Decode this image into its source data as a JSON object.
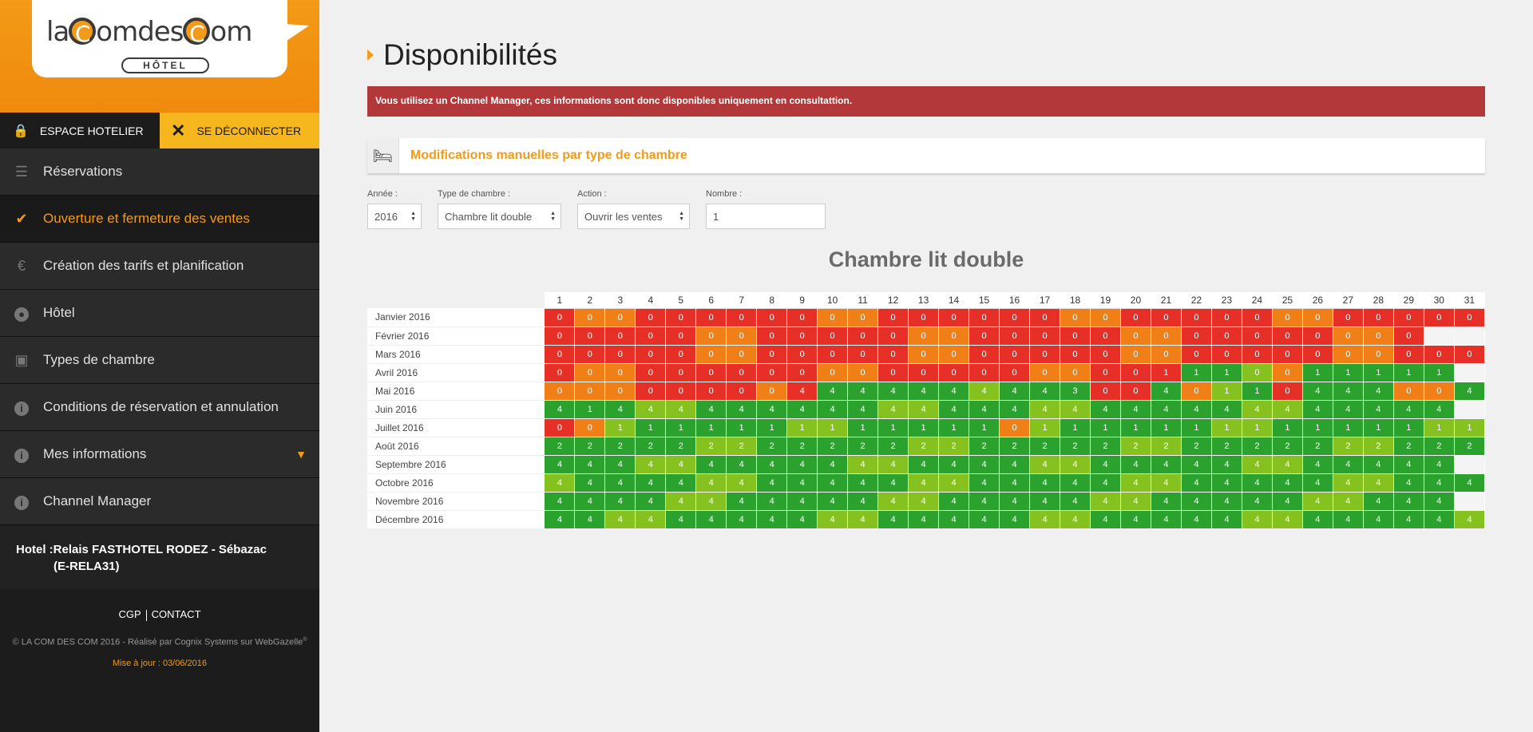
{
  "sidebar": {
    "logo_text_1": "la",
    "logo_c": "C",
    "logo_text_2": "omdes",
    "logo_text_3": "om",
    "logo_sub": "HÔTEL",
    "espace_label": "ESPACE HOTELIER",
    "logout_label": "SE DÉCONNECTER",
    "nav": [
      {
        "label": "Réservations",
        "icon": "list-icon"
      },
      {
        "label": "Ouverture et fermeture des ventes",
        "icon": "check-icon"
      },
      {
        "label": "Création des tarifs et planification",
        "icon": "euro-icon"
      },
      {
        "label": "Hôtel",
        "icon": "globe-icon"
      },
      {
        "label": "Types de chambre",
        "icon": "bookmark-icon"
      },
      {
        "label": "Conditions de réservation et annulation",
        "icon": "info-icon"
      },
      {
        "label": "Mes informations",
        "icon": "info-icon"
      },
      {
        "label": "Channel Manager",
        "icon": "info-icon"
      }
    ],
    "hotel_line1": "Hotel :Relais FASTHOTEL RODEZ - Sébazac",
    "hotel_line2": "(E-RELA31)",
    "footer_cgp": "CGP",
    "footer_contact": "CONTACT",
    "copyright": "© LA COM DES COM 2016 - Réalisé par Cognix Systems sur WebGazelle",
    "copyright_sup": "®",
    "update": "Mise à jour : 03/06/2016"
  },
  "main": {
    "title": "Disponibilités",
    "alert": "Vous utilisez un Channel Manager, ces informations sont donc disponibles uniquement en consultattion.",
    "panel_title": "Modifications manuelles par type de chambre",
    "filters": {
      "year_label": "Année :",
      "year_value": "2016",
      "type_label": "Type de chambre :",
      "type_value": "Chambre lit double",
      "action_label": "Action :",
      "action_value": "Ouvrir les ventes",
      "nombre_label": "Nombre :",
      "nombre_value": "1"
    },
    "grid_title": "Chambre lit double"
  },
  "colors": {
    "accent": "#f39a17",
    "closed_red": "#e63027",
    "low_orange": "#f07f17",
    "open_green": "#2ba12e",
    "open_lime": "#86c21f",
    "alert_red": "#b3383a"
  },
  "calendar": {
    "days": [
      "1",
      "2",
      "3",
      "4",
      "5",
      "6",
      "7",
      "8",
      "9",
      "10",
      "11",
      "12",
      "13",
      "14",
      "15",
      "16",
      "17",
      "18",
      "19",
      "20",
      "21",
      "22",
      "23",
      "24",
      "25",
      "26",
      "27",
      "28",
      "29",
      "30",
      "31"
    ],
    "legend_codes": {
      "R": "red",
      "O": "orange",
      "G": "green",
      "L": "lime"
    },
    "months": [
      {
        "name": "Janvier 2016",
        "values": "0000000000000000000000000000000",
        "colors": "ROORRRRRROORRRRRROORRRRROORRRRROO"
      },
      {
        "name": "Février 2016",
        "values": "00000000000000000000000000000",
        "colors": "RRRRROORRRRROORRRRROORRRRROORRR"
      },
      {
        "name": "Mars 2016",
        "values": "0000000000000000000000000000000",
        "colors": "RRRRROORRRRROORRRRROORRRRROORRRRR"
      },
      {
        "name": "Avril 2016",
        "values": "000000000000000000001110011111",
        "colors": "ROORRRRRROORRRRROORRRGGLOGGGGGL"
      },
      {
        "name": "Mai 2016",
        "values": "0000000044444444430040110444004 4",
        "colors": "OOORRRRORGGGGGLGGGRRGOLGRGGGOOGG"
      },
      {
        "name": "Juin 2016",
        "values": "414444444444444444444444444444",
        "colors": "GGGLLGGGGGGLLGGGLLGGGGGLLGGGGGG"
      },
      {
        "name": "Juillet 2016",
        "values": "0011111111111110111111111111111",
        "colors": "ROLGGGGGLLGGGGGOLGGGGGLLGGGGGLL"
      },
      {
        "name": "Août 2016",
        "values": "2222222222222222222222222222222",
        "colors": "GGGGGLLGGGGGLLGGGGGLLGGGGGLLGGG"
      },
      {
        "name": "Septembre 2016",
        "values": "444444444444444444444444444444",
        "colors": "GGGLLGGGGGLLGGGGLLGGGGGLLGGGGGL"
      },
      {
        "name": "Octobre 2016",
        "values": "4444444444444444444444444444444",
        "colors": "LGGGGLLGGGGGLLGGGGGLLGGGGGLLGGG"
      },
      {
        "name": "Novembre 2016",
        "values": "444444444444444444444444444444",
        "colors": "GGGGLLGGGGGLLGGGGGLLGGGGGLLGGGL"
      },
      {
        "name": "Décembre 2016",
        "values": "4444444444444444444444444444444",
        "colors": "GGLLGGGGGLLGGGGGLLGGGGGLLGGGGGL"
      }
    ]
  }
}
